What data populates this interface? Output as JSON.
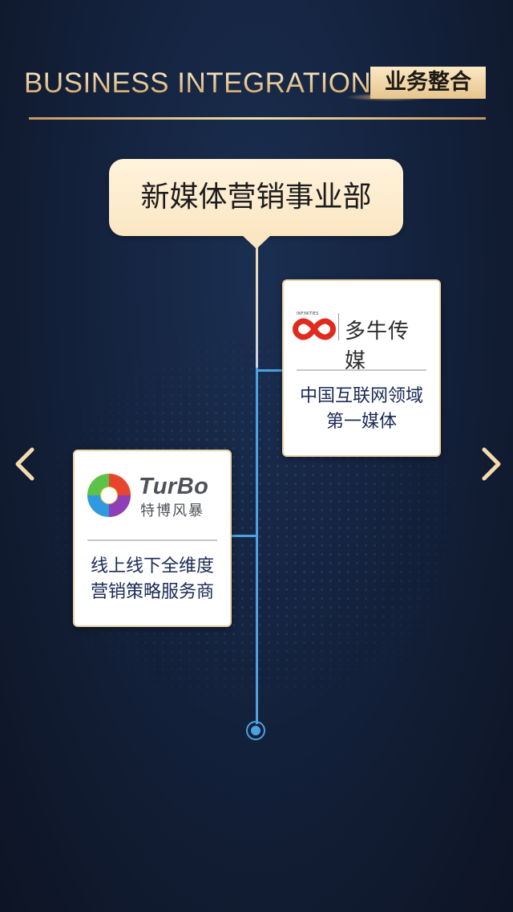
{
  "header": {
    "title_en": "BUSINESS INTEGRATION",
    "title_cn": "业务整合"
  },
  "department": {
    "name": "新媒体营销事业部"
  },
  "cards": [
    {
      "logo_small_text": "INFINITIES",
      "logo_name": "多牛传媒",
      "description": [
        "中国互联网领域",
        "第一媒体"
      ]
    },
    {
      "logo_name_en": "TurBo",
      "logo_name_cn": "特博风暴",
      "description": [
        "线上线下全维度",
        "营销策略服务商"
      ]
    }
  ],
  "nav": {
    "prev_icon": "chevron-left-icon",
    "next_icon": "chevron-right-icon"
  },
  "colors": {
    "gold": "#e7c58d",
    "card_bg": "#ffffff",
    "timeline_blue": "#4aa2e0",
    "text_navy": "#1a2a55"
  }
}
